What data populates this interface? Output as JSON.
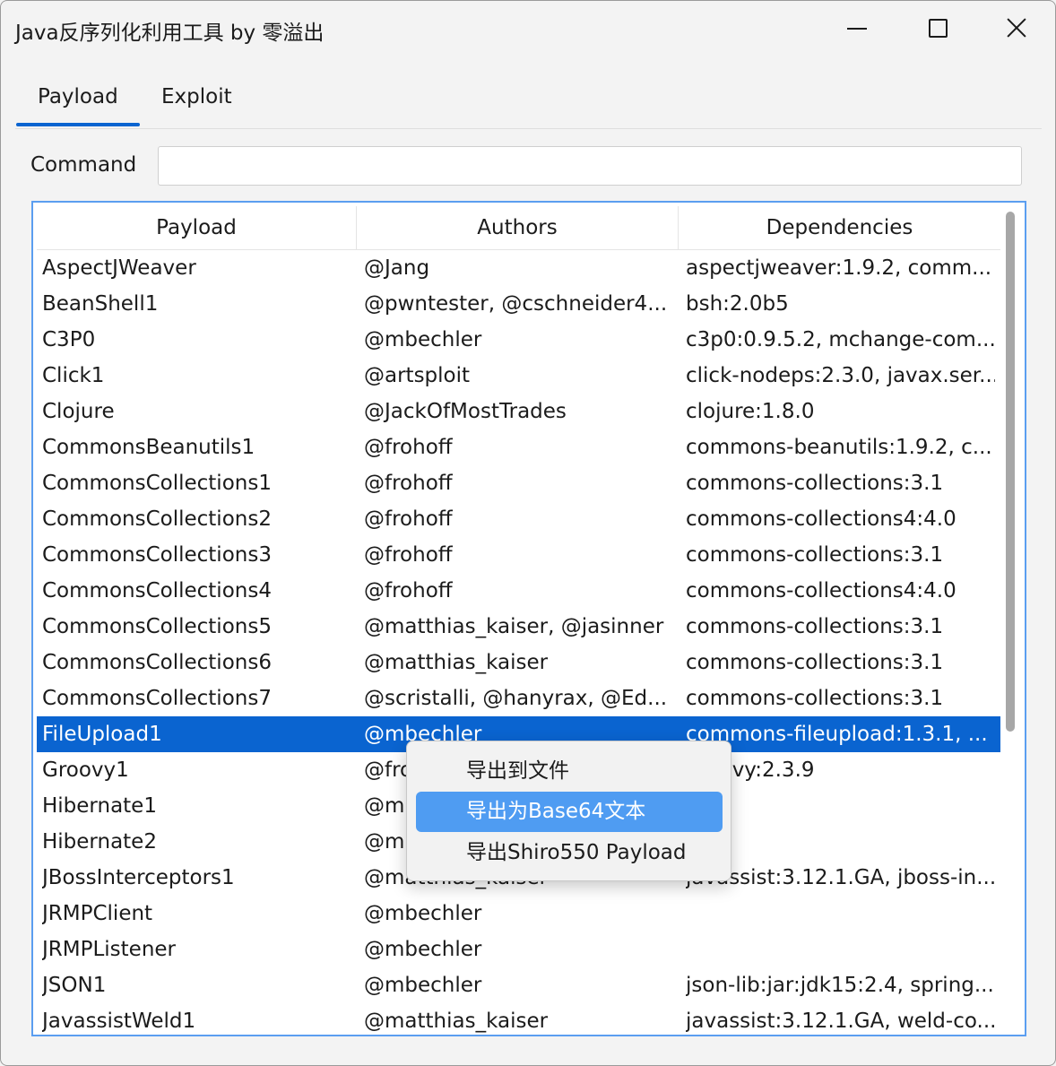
{
  "window": {
    "title": "Java反序列化利用工具 by 零溢出"
  },
  "tabs": [
    {
      "label": "Payload",
      "active": true
    },
    {
      "label": "Exploit",
      "active": false
    }
  ],
  "command": {
    "label": "Command",
    "value": ""
  },
  "table": {
    "columns": [
      "Payload",
      "Authors",
      "Dependencies"
    ],
    "rows": [
      {
        "payload": "AspectJWeaver",
        "authors": "@Jang",
        "deps": "aspectjweaver:1.9.2, comm..."
      },
      {
        "payload": "BeanShell1",
        "authors": "@pwntester, @cschneider4...",
        "deps": "bsh:2.0b5"
      },
      {
        "payload": "C3P0",
        "authors": "@mbechler",
        "deps": "c3p0:0.9.5.2, mchange-com..."
      },
      {
        "payload": "Click1",
        "authors": "@artsploit",
        "deps": "click-nodeps:2.3.0, javax.ser..."
      },
      {
        "payload": "Clojure",
        "authors": "@JackOfMostTrades",
        "deps": "clojure:1.8.0"
      },
      {
        "payload": "CommonsBeanutils1",
        "authors": "@frohoff",
        "deps": "commons-beanutils:1.9.2, c..."
      },
      {
        "payload": "CommonsCollections1",
        "authors": "@frohoff",
        "deps": "commons-collections:3.1"
      },
      {
        "payload": "CommonsCollections2",
        "authors": "@frohoff",
        "deps": "commons-collections4:4.0"
      },
      {
        "payload": "CommonsCollections3",
        "authors": "@frohoff",
        "deps": "commons-collections:3.1"
      },
      {
        "payload": "CommonsCollections4",
        "authors": "@frohoff",
        "deps": "commons-collections4:4.0"
      },
      {
        "payload": "CommonsCollections5",
        "authors": "@matthias_kaiser, @jasinner",
        "deps": "commons-collections:3.1"
      },
      {
        "payload": "CommonsCollections6",
        "authors": "@matthias_kaiser",
        "deps": "commons-collections:3.1"
      },
      {
        "payload": "CommonsCollections7",
        "authors": "@scristalli, @hanyrax, @Ed...",
        "deps": "commons-collections:3.1"
      },
      {
        "payload": "FileUpload1",
        "authors": "@mbechler",
        "deps": "commons-fileupload:1.3.1, ...",
        "selected": true
      },
      {
        "payload": "Groovy1",
        "authors": "@frohoff",
        "deps": "groovy:2.3.9"
      },
      {
        "payload": "Hibernate1",
        "authors": "@mbechler",
        "deps": ""
      },
      {
        "payload": "Hibernate2",
        "authors": "@mbechler",
        "deps": ""
      },
      {
        "payload": "JBossInterceptors1",
        "authors": "@matthias_kaiser",
        "deps": "javassist:3.12.1.GA, jboss-in..."
      },
      {
        "payload": "JRMPClient",
        "authors": "@mbechler",
        "deps": ""
      },
      {
        "payload": "JRMPListener",
        "authors": "@mbechler",
        "deps": ""
      },
      {
        "payload": "JSON1",
        "authors": "@mbechler",
        "deps": "json-lib:jar:jdk15:2.4, spring..."
      },
      {
        "payload": "JavassistWeld1",
        "authors": "@matthias_kaiser",
        "deps": "javassist:3.12.1.GA, weld-co..."
      }
    ]
  },
  "context_menu": {
    "items": [
      {
        "label": "导出到文件"
      },
      {
        "label": "导出为Base64文本",
        "highlighted": true
      },
      {
        "label": "导出Shiro550 Payload"
      }
    ]
  }
}
